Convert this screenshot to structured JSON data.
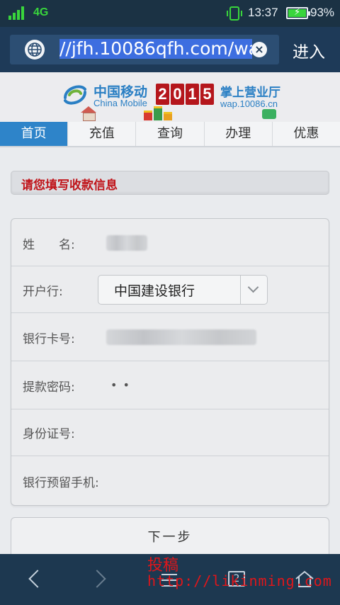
{
  "status_bar": {
    "network": "4G",
    "time": "13:37",
    "battery": "93%",
    "battery_level": 0.93
  },
  "address_bar": {
    "url": "//jfh.10086qfh.com/wa",
    "go_label": "进入"
  },
  "banner": {
    "brand_cn": "中国移动",
    "brand_en": "China Mobile",
    "year_digits": [
      "2",
      "0",
      "1",
      "5"
    ],
    "slogan": "掌上营业厅",
    "site": "wap.10086.cn",
    "brand_color": "#2a7fc4"
  },
  "nav": {
    "tabs": [
      {
        "label": "首页",
        "active": true
      },
      {
        "label": "充值",
        "active": false
      },
      {
        "label": "查询",
        "active": false
      },
      {
        "label": "办理",
        "active": false
      },
      {
        "label": "优惠",
        "active": false
      }
    ],
    "active_color": "#2e84c9"
  },
  "section": {
    "title": "请您填写收款信息",
    "title_color": "#c0141a"
  },
  "form": {
    "name_label": "姓　　名:",
    "bank_label": "开户行:",
    "bank_value": "中国建设银行",
    "card_label": "银行卡号:",
    "password_label": "提款密码:",
    "password_value": "••",
    "id_label": "身份证号:",
    "phone_label": "银行预留手机:"
  },
  "next_button": {
    "label": "下一步"
  },
  "watermark": {
    "line1": "投稿",
    "line2": "http://likinming.com"
  }
}
